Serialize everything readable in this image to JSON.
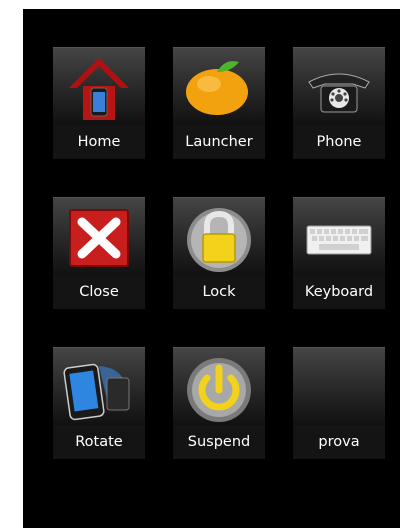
{
  "grid": {
    "home": {
      "label": "Home",
      "icon": "house-phone-icon"
    },
    "launcher": {
      "label": "Launcher",
      "icon": "orange-fruit-icon"
    },
    "phone": {
      "label": "Phone",
      "icon": "rotary-telephone-icon"
    },
    "close": {
      "label": "Close",
      "icon": "red-x-icon"
    },
    "lock": {
      "label": "Lock",
      "icon": "padlock-icon"
    },
    "keyboard": {
      "label": "Keyboard",
      "icon": "keyboard-icon"
    },
    "rotate": {
      "label": "Rotate",
      "icon": "rotate-device-icon"
    },
    "suspend": {
      "label": "Suspend",
      "icon": "power-icon"
    },
    "prova": {
      "label": "prova",
      "icon": ""
    }
  },
  "colors": {
    "background": "#000000",
    "tile_top": "#454545",
    "label_bg": "#141414",
    "text": "#ffffff"
  }
}
